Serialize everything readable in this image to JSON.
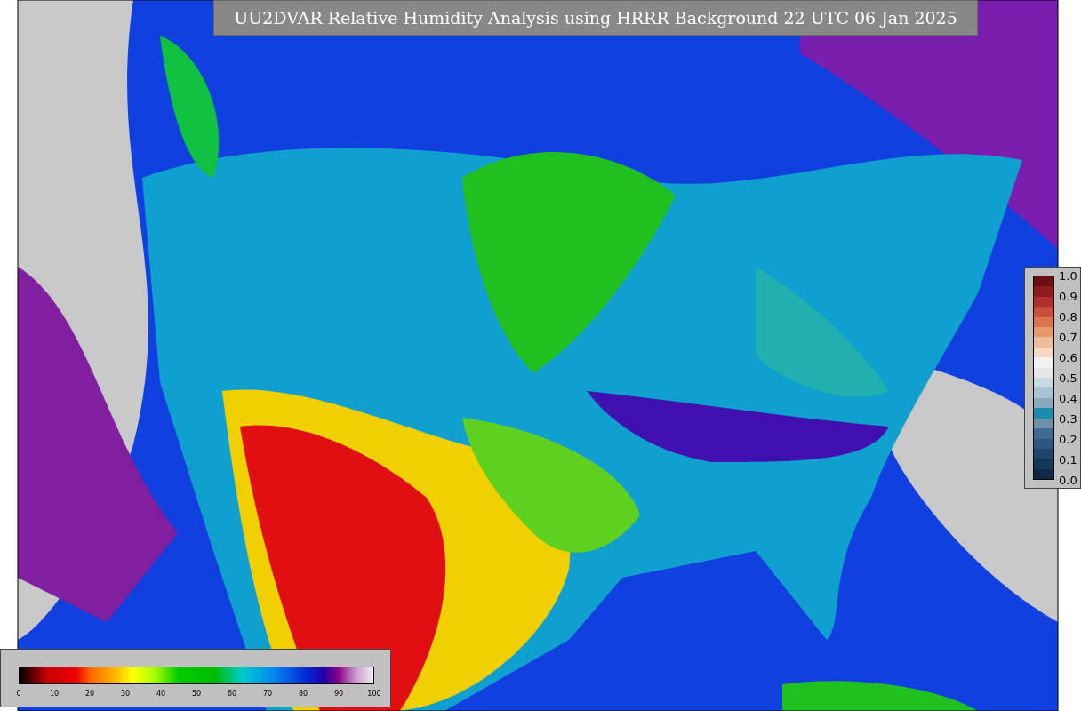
{
  "title": "UU2DVAR Relative Humidity Analysis using HRRR Background 22 UTC 06 Jan 2025",
  "horizontal_colorbar": {
    "ticks": [
      "0",
      "10",
      "20",
      "30",
      "40",
      "50",
      "60",
      "70",
      "80",
      "90",
      "100"
    ]
  },
  "vertical_colorbar": {
    "ticks": [
      "1.0",
      "0.9",
      "0.8",
      "0.7",
      "0.6",
      "0.5",
      "0.4",
      "0.3",
      "0.2",
      "0.1",
      "0.0"
    ]
  }
}
